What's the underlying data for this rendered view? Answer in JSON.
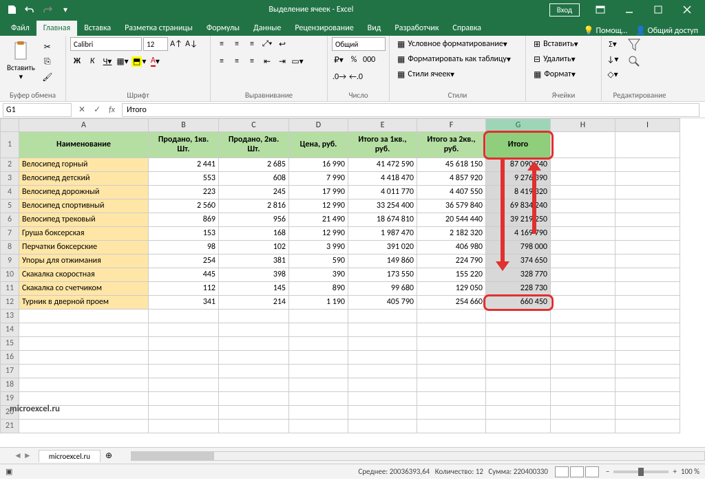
{
  "titlebar": {
    "title": "Выделение ячеек - Excel",
    "login": "Вход"
  },
  "tabs": [
    "Файл",
    "Главная",
    "Вставка",
    "Разметка страницы",
    "Формулы",
    "Данные",
    "Рецензирование",
    "Вид",
    "Разработчик",
    "Справка"
  ],
  "tab_active": 1,
  "help": {
    "search": "Помощ…",
    "share": "Общий доступ"
  },
  "ribbon": {
    "groups": [
      "Буфер обмена",
      "Шрифт",
      "Выравнивание",
      "Число",
      "Стили",
      "Ячейки",
      "Редактирование"
    ],
    "paste": "Вставить",
    "font_name": "Calibri",
    "font_size": "12",
    "number_format": "Общий",
    "cond_fmt": "Условное форматирование",
    "fmt_table": "Форматировать как таблицу",
    "cell_styles": "Стили ячеек",
    "insert": "Вставить",
    "delete": "Удалить",
    "format": "Формат"
  },
  "namebox": "G1",
  "formula": "Итого",
  "col_widths": {
    "A": 188,
    "B": 102,
    "C": 102,
    "D": 86,
    "E": 100,
    "F": 100,
    "G": 94,
    "H": 94,
    "I": 94
  },
  "columns": [
    "A",
    "B",
    "C",
    "D",
    "E",
    "F",
    "G",
    "H",
    "I"
  ],
  "selected_col": "G",
  "headers": [
    "Наименование",
    "Продано, 1кв. Шт.",
    "Продано, 2кв. Шт.",
    "Цена, руб.",
    "Итого за 1кв., руб.",
    "Итого за 2кв., руб.",
    "Итого"
  ],
  "rows": [
    {
      "n": "Велосипед горный",
      "q1": "2 441",
      "q2": "2 685",
      "p": "16 990",
      "t1": "41 472 590",
      "t2": "45 618 150",
      "t": "87 090 740"
    },
    {
      "n": "Велосипед детский",
      "q1": "553",
      "q2": "608",
      "p": "7 990",
      "t1": "4 418 470",
      "t2": "4 857 920",
      "t": "9 276 390"
    },
    {
      "n": "Велосипед дорожный",
      "q1": "223",
      "q2": "245",
      "p": "17 990",
      "t1": "4 011 770",
      "t2": "4 407 550",
      "t": "8 419 320"
    },
    {
      "n": "Велосипед спортивный",
      "q1": "2 560",
      "q2": "2 816",
      "p": "12 990",
      "t1": "33 254 400",
      "t2": "36 579 840",
      "t": "69 834 240"
    },
    {
      "n": "Велосипед трековый",
      "q1": "869",
      "q2": "956",
      "p": "21 490",
      "t1": "18 674 810",
      "t2": "20 544 440",
      "t": "39 219 250"
    },
    {
      "n": "Груша боксерская",
      "q1": "153",
      "q2": "168",
      "p": "12 990",
      "t1": "1 987 470",
      "t2": "2 182 320",
      "t": "4 169 790"
    },
    {
      "n": "Перчатки боксерские",
      "q1": "98",
      "q2": "102",
      "p": "3 990",
      "t1": "391 020",
      "t2": "406 980",
      "t": "798 000"
    },
    {
      "n": "Упоры для отжимания",
      "q1": "254",
      "q2": "381",
      "p": "590",
      "t1": "149 860",
      "t2": "224 790",
      "t": "374 650"
    },
    {
      "n": "Скакалка скоростная",
      "q1": "445",
      "q2": "398",
      "p": "390",
      "t1": "173 550",
      "t2": "155 220",
      "t": "328 770"
    },
    {
      "n": "Скакалка со счетчиком",
      "q1": "112",
      "q2": "145",
      "p": "890",
      "t1": "99 680",
      "t2": "129 050",
      "t": "228 730"
    },
    {
      "n": "Турник в дверной проем",
      "q1": "341",
      "q2": "214",
      "p": "1 190",
      "t1": "405 790",
      "t2": "254 660",
      "t": "660 450"
    }
  ],
  "empty_rows": 9,
  "sheet_tab": "microexcel.ru",
  "status": {
    "avg_label": "Среднее:",
    "avg": "20036393,64",
    "count_label": "Количество:",
    "count": "12",
    "sum_label": "Сумма:",
    "sum": "220400330",
    "zoom": "100 %"
  },
  "watermark": "microexcel.ru"
}
